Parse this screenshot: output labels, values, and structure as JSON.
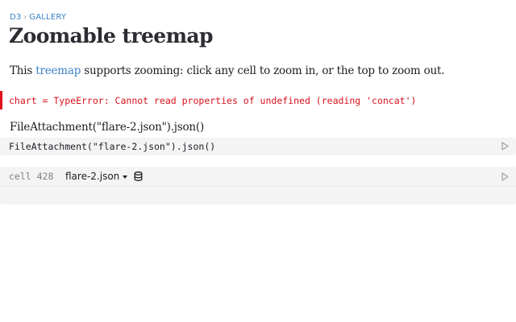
{
  "breadcrumb": {
    "root": "D3",
    "separator": "›",
    "section": "GALLERY"
  },
  "page": {
    "title": "Zoomable treemap",
    "intro_before": "This ",
    "intro_link": "treemap",
    "intro_after": " supports zooming: click any cell to zoom in, or the top to zoom out."
  },
  "error_cell": {
    "text": "chart = TypeError: Cannot read properties of undefined (reading 'concat')",
    "color": "#d8111d"
  },
  "output": {
    "text": "FileAttachment(\"flare-2.json\").json()"
  },
  "code_cell": {
    "code": "FileAttachment(\"flare-2.json\").json()"
  },
  "file_cell": {
    "label": "cell 428",
    "file_name": "flare-2.json",
    "icons": [
      "chevron-down-icon",
      "database-icon",
      "play-icon"
    ]
  },
  "colors": {
    "link": "#3b82c4",
    "cell_bg": "#f4f4f5",
    "error_bar": "#e1121d"
  }
}
